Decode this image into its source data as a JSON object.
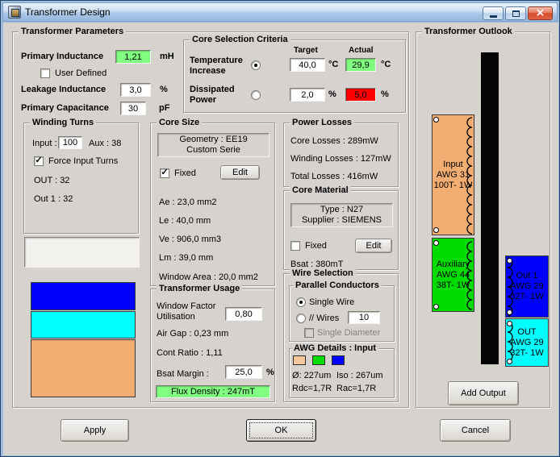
{
  "window": {
    "title": "Transformer Design"
  },
  "icons": {
    "checkmark": "✓",
    "close": "×"
  },
  "colors": {
    "good": "#80FF80",
    "bad": "#FF0000",
    "bar_blue": "#0000FF",
    "bar_cyan": "#00FFFF",
    "bar_orange": "#F2AE72",
    "swatch1": "#F6C79B",
    "swatch2": "#00DC00",
    "swatch3": "#0000FF"
  },
  "params": {
    "legend": "Transformer Parameters",
    "primary_inductance_label": "Primary Inductance",
    "primary_inductance_value": "1,21",
    "primary_inductance_unit": "mH",
    "user_defined_label": "User Defined",
    "leakage_label": "Leakage Inductance",
    "leakage_value": "3,0",
    "leakage_unit": "%",
    "capacitance_label": "Primary Capacitance",
    "capacitance_value": "30",
    "capacitance_unit": "pF"
  },
  "winding_turns": {
    "legend": "Winding Turns",
    "input_label": "Input :",
    "input_value": "100",
    "aux_text": "Aux : 38",
    "force_label": "Force Input Turns",
    "out_text": "OUT : 32",
    "out1_text": "Out 1 : 32"
  },
  "core_selection": {
    "legend": "Core Selection Criteria",
    "target_header": "Target",
    "actual_header": "Actual",
    "temp_label1": "Temperature",
    "temp_label2": "Increase",
    "temp_target": "40,0",
    "temp_unit": "°C",
    "temp_actual": "29,9",
    "power_label1": "Dissipated",
    "power_label2": "Power",
    "power_target": "2,0",
    "power_unit": "%",
    "power_actual": "5,0"
  },
  "core_size": {
    "legend": "Core Size",
    "geometry_line1": "Geometry : EE19",
    "geometry_line2": "Custom Serie",
    "fixed_label": "Fixed",
    "edit_label": "Edit",
    "rows": [
      "Ae : 23,0 mm2",
      "Le : 40,0 mm",
      "Ve : 906,0 mm3",
      "Lm : 39,0 mm",
      "Window Area : 20,0 mm2"
    ]
  },
  "usage": {
    "legend": "Transformer Usage",
    "wf_line1": "Window Factor",
    "wf_line2": "Utilisation",
    "wf_value": "0,80",
    "air_gap": "Air Gap : 0,23 mm",
    "cont_ratio": "Cont Ratio : 1,11",
    "bsat_label": "Bsat Margin :",
    "bsat_value": "25,0",
    "bsat_unit": "%",
    "flux_text": "Flux Density : 247mT"
  },
  "losses": {
    "legend": "Power Losses",
    "rows": [
      "Core Losses : 289mW",
      "Winding Losses : 127mW",
      "Total Losses : 416mW"
    ]
  },
  "material": {
    "legend": "Core Material",
    "type_line1": "Type : N27",
    "type_line2": "Supplier : SIEMENS",
    "fixed_label": "Fixed",
    "edit_label": "Edit",
    "bsat_text": "Bsat : 380mT"
  },
  "wire": {
    "legend": "Wire Selection",
    "parallel_legend": "Parallel Conductors",
    "single_wire_label": "Single Wire",
    "wires_label": "// Wires",
    "wires_value": "10",
    "single_diameter_label": "Single Diameter",
    "awg_legend": "AWG Details : Input",
    "diameter_text": "Ø: 227um",
    "iso_text": "Iso : 267um",
    "rdc_text": "Rdc=1,7R",
    "rac_text": "Rac=1,7R"
  },
  "outlook": {
    "legend": "Transformer Outlook",
    "windings": [
      {
        "name": "Input",
        "awg": "AWG 31",
        "turns": "100T- 1W",
        "color": "#F2AE72"
      },
      {
        "name": "Auxiliary",
        "awg": "AWG 44",
        "turns": "38T- 1W",
        "color": "#00DC00"
      },
      {
        "name": "Out 1",
        "awg": "AWG 29",
        "turns": "32T- 1W",
        "color": "#0000FF"
      },
      {
        "name": "OUT",
        "awg": "AWG 29",
        "turns": "32T- 1W",
        "color": "#00FFFF"
      }
    ],
    "add_output_label": "Add Output"
  },
  "actions": {
    "apply": "Apply",
    "ok": "OK",
    "cancel": "Cancel"
  }
}
